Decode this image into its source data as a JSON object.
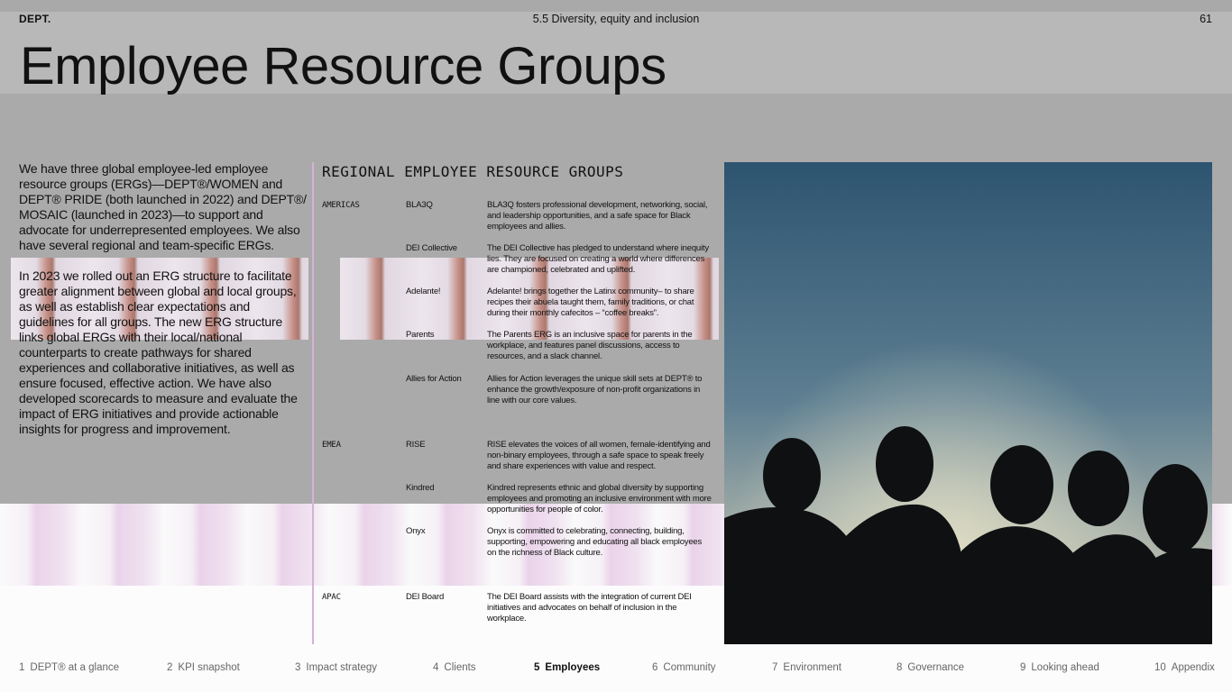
{
  "header": {
    "logo": "DEPT.",
    "section": "5.5 Diversity, equity and inclusion",
    "page_number": "61",
    "title": "Employee Resource Groups"
  },
  "intro": {
    "paragraphs": [
      "We have three global employee-led employee resource groups (ERGs)—DEPT®/WOMEN and DEPT® PRIDE (both launched in 2022) and DEPT®/ MOSAIC (launched in 2023)—to support and advocate for underrepresented employees. We also have several regional and team-specific ERGs.",
      "In 2023 we rolled out an ERG structure to facilitate greater alignment between global and local groups, as well as establish clear expectations and guidelines for all groups. The new ERG structure links global ERGs with their local/national counterparts to create pathways for shared experiences and collaborative initiatives, as well as ensure focused, effective action. We have also developed scorecards to measure and evaluate the impact of ERG initiatives and provide actionable insights for progress and improvement."
    ]
  },
  "regional": {
    "heading": "REGIONAL EMPLOYEE RESOURCE GROUPS",
    "rows": [
      {
        "region": "AMERICAS",
        "name": "BLA3Q",
        "description": "BLA3Q fosters professional development, networking, social, and leadership opportunities, and a safe space for Black employees and allies."
      },
      {
        "region": "",
        "name": "DEI Collective",
        "description": "The DEI Collective has pledged to understand where inequity lies. They are focused on creating a world where differences are championed, celebrated and uplifted."
      },
      {
        "region": "",
        "name": "Adelante!",
        "description": "Adelante! brings together the Latinx community– to share recipes their abuela taught them, family traditions, or chat during their monthly cafecitos – “coffee breaks”."
      },
      {
        "region": "",
        "name": "Parents",
        "description": "The Parents ERG is an inclusive space for parents in the workplace, and features panel discussions, access to resources, and a slack channel."
      },
      {
        "region": "",
        "name": "Allies for Action",
        "description": "Allies for Action leverages the unique skill sets at DEPT® to enhance the growth/exposure of non-profit organizations in line with our core values."
      },
      {
        "region": "EMEA",
        "name": "RISE",
        "description": "RISE elevates the voices of all women, female-identifying and non-binary employees, through a safe space to speak freely and share experiences with value and respect."
      },
      {
        "region": "",
        "name": "Kindred",
        "description": "Kindred represents ethnic and global diversity by supporting employees and promoting an inclusive environment with more opportunities for people of color."
      },
      {
        "region": "",
        "name": "Onyx",
        "description": "Onyx is committed to celebrating, connecting, building, supporting, empowering and educating all black employees on the richness of Black culture."
      },
      {
        "region": "APAC",
        "name": "DEI Board",
        "description": "The DEI Board assists with the integration of current DEI initiatives and advocates on behalf of inclusion in the workplace."
      }
    ]
  },
  "footer_nav": [
    {
      "num": "1",
      "label": "DEPT® at a glance",
      "active": false
    },
    {
      "num": "2",
      "label": "KPI snapshot",
      "active": false
    },
    {
      "num": "3",
      "label": "Impact strategy",
      "active": false
    },
    {
      "num": "4",
      "label": "Clients",
      "active": false
    },
    {
      "num": "5",
      "label": "Employees",
      "active": true
    },
    {
      "num": "6",
      "label": "Community",
      "active": false
    },
    {
      "num": "7",
      "label": "Environment",
      "active": false
    },
    {
      "num": "8",
      "label": "Governance",
      "active": false
    },
    {
      "num": "9",
      "label": "Looking ahead",
      "active": false
    },
    {
      "num": "10",
      "label": "Appendix",
      "active": false
    }
  ],
  "colors": {
    "divider": "#d8b0d8",
    "sky_top": "#2d5470",
    "sky_glow": "#c8c7b8"
  }
}
